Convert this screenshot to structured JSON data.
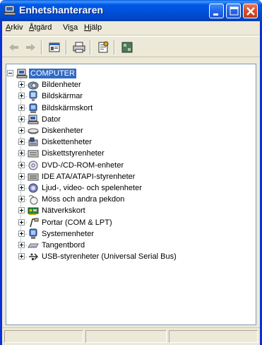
{
  "window": {
    "title": "Enhetshanteraren",
    "title_icon": "computer-icon",
    "controls": [
      "minimize",
      "maximize",
      "close"
    ]
  },
  "menu": [
    {
      "label": "Arkiv",
      "mnemonic": "A"
    },
    {
      "label": "Åtgärd",
      "mnemonic": "Å"
    },
    {
      "label": "Visa",
      "mnemonic": "s"
    },
    {
      "label": "Hjälp",
      "mnemonic": "H"
    }
  ],
  "toolbar": {
    "buttons": [
      "back-arrow-icon",
      "forward-arrow-icon",
      "console-tree-icon",
      "print-icon",
      "properties-icon",
      "help-icon"
    ]
  },
  "tree": {
    "root": {
      "label": "COMPUTER",
      "icon": "computer-icon",
      "expanded": true,
      "selected": true
    },
    "children": [
      {
        "label": "Bildenheter",
        "icon": "camera-icon"
      },
      {
        "label": "Bildskärmar",
        "icon": "monitor-icon"
      },
      {
        "label": "Bildskärmskort",
        "icon": "display-adapter-icon"
      },
      {
        "label": "Dator",
        "icon": "computer-icon"
      },
      {
        "label": "Diskenheter",
        "icon": "disk-drive-icon"
      },
      {
        "label": "Diskettenheter",
        "icon": "floppy-drive-icon"
      },
      {
        "label": "Diskettstyrenheter",
        "icon": "floppy-controller-icon"
      },
      {
        "label": "DVD-/CD-ROM-enheter",
        "icon": "dvd-icon"
      },
      {
        "label": "IDE ATA/ATAPI-styrenheter",
        "icon": "ide-controller-icon"
      },
      {
        "label": "Ljud-, video- och spelenheter",
        "icon": "sound-icon"
      },
      {
        "label": "Möss och andra pekdon",
        "icon": "mouse-icon"
      },
      {
        "label": "Nätverkskort",
        "icon": "network-card-icon"
      },
      {
        "label": "Portar (COM & LPT)",
        "icon": "port-icon"
      },
      {
        "label": "Systemenheter",
        "icon": "system-device-icon"
      },
      {
        "label": "Tangentbord",
        "icon": "keyboard-icon"
      },
      {
        "label": "USB-styrenheter (Universal Serial Bus)",
        "icon": "usb-icon"
      }
    ]
  },
  "colors": {
    "titlebar": "#0058e6",
    "selection": "#316ac5",
    "window_bg": "#ece9d8",
    "close_button": "#d8502c"
  }
}
